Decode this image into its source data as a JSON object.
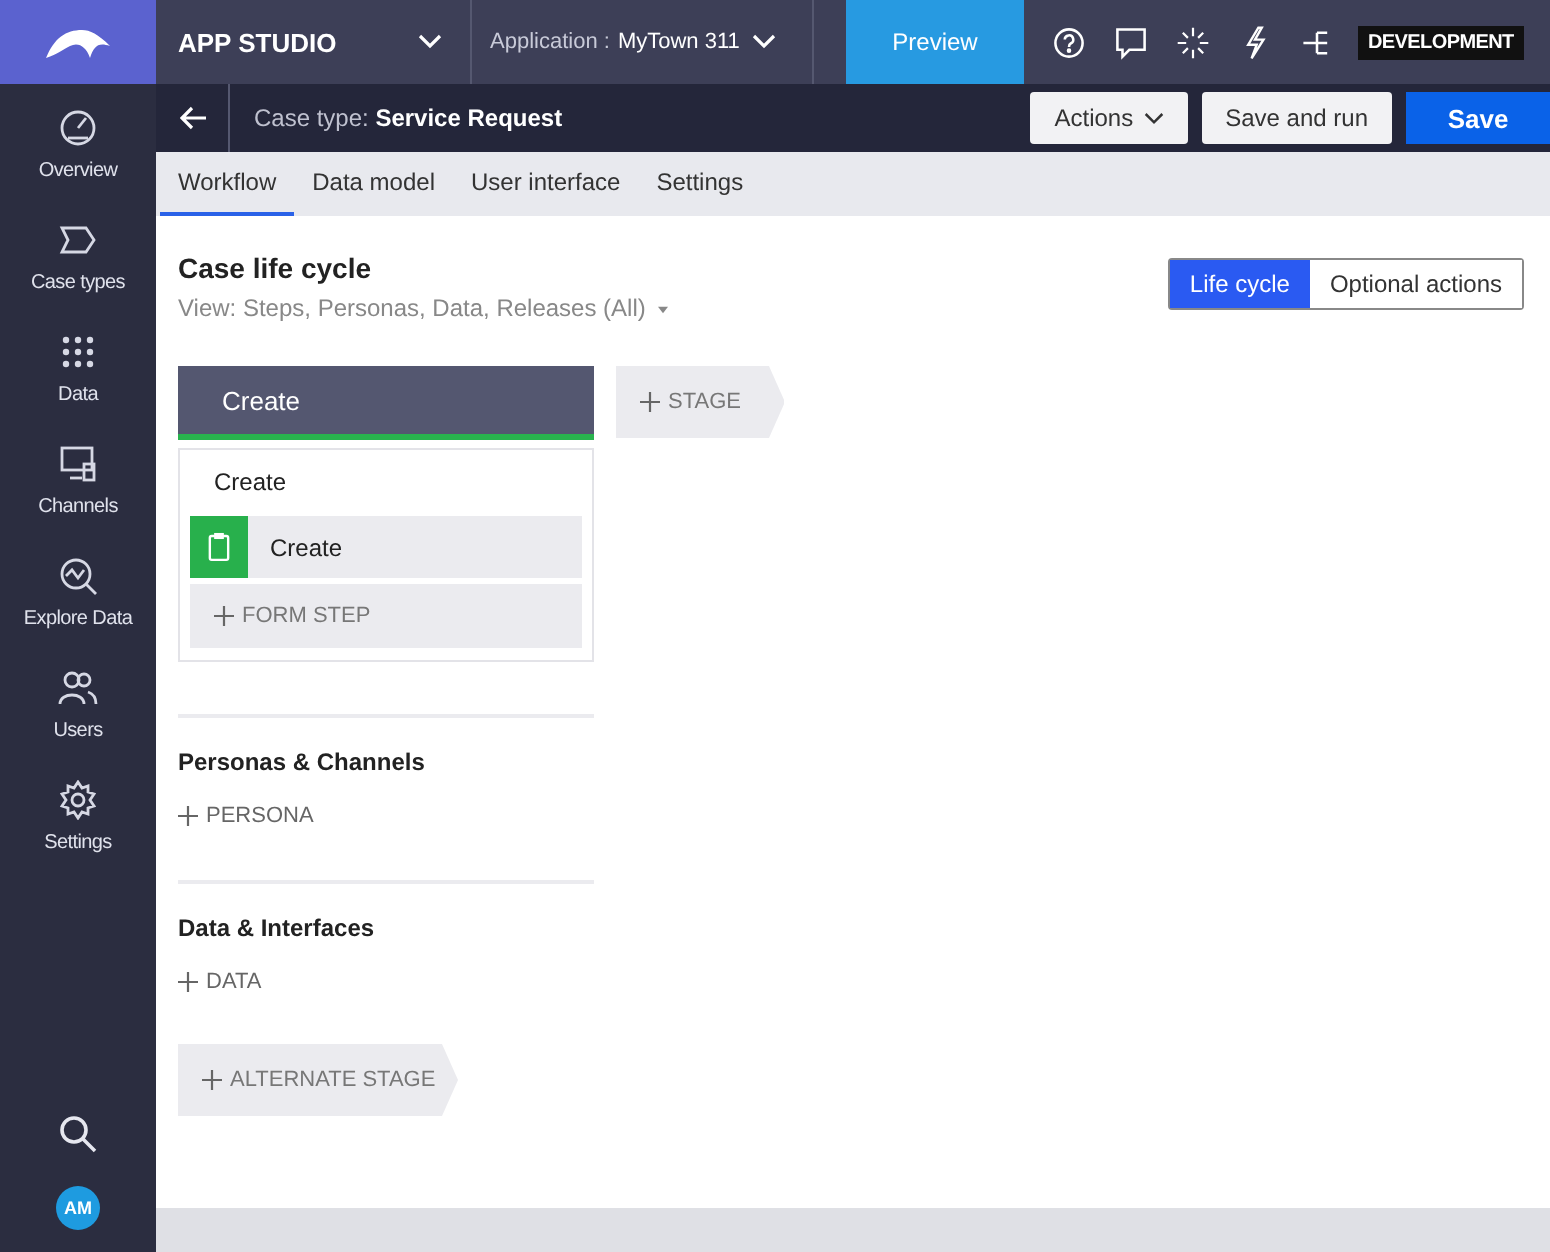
{
  "top_bar": {
    "studio": "APP STUDIO",
    "application_label": "Application :",
    "application_name": "MyTown 311",
    "preview": "Preview",
    "environment": "DEVELOPMENT"
  },
  "case_bar": {
    "label": "Case type:",
    "name": "Service Request",
    "actions": "Actions",
    "save_and_run": "Save and run",
    "save": "Save"
  },
  "tabs": [
    {
      "label": "Workflow",
      "selected": true
    },
    {
      "label": "Data model",
      "selected": false
    },
    {
      "label": "User interface",
      "selected": false
    },
    {
      "label": "Settings",
      "selected": false
    }
  ],
  "sidebar": {
    "items": [
      {
        "kind": "overview",
        "label": "Overview"
      },
      {
        "kind": "case-types",
        "label": "Case types"
      },
      {
        "kind": "data",
        "label": "Data"
      },
      {
        "kind": "channels",
        "label": "Channels"
      },
      {
        "kind": "explore",
        "label": "Explore Data"
      },
      {
        "kind": "users",
        "label": "Users"
      },
      {
        "kind": "settings",
        "label": "Settings"
      }
    ],
    "avatar": "AM"
  },
  "lifecycle": {
    "title": "Case life cycle",
    "view": "View: Steps, Personas, Data, Releases (All)",
    "toggle": [
      {
        "label": "Life cycle",
        "selected": true
      },
      {
        "label": "Optional actions",
        "selected": false
      }
    ],
    "stage": {
      "name": "Create",
      "process": "Create",
      "steps": [
        {
          "label": "Create"
        }
      ],
      "add_step": "FORM STEP"
    },
    "add_stage": "STAGE",
    "sections": [
      {
        "title": "Personas & Channels",
        "add": "PERSONA"
      },
      {
        "title": "Data & Interfaces",
        "add": "DATA"
      }
    ],
    "add_alternate": "ALTERNATE STAGE"
  }
}
